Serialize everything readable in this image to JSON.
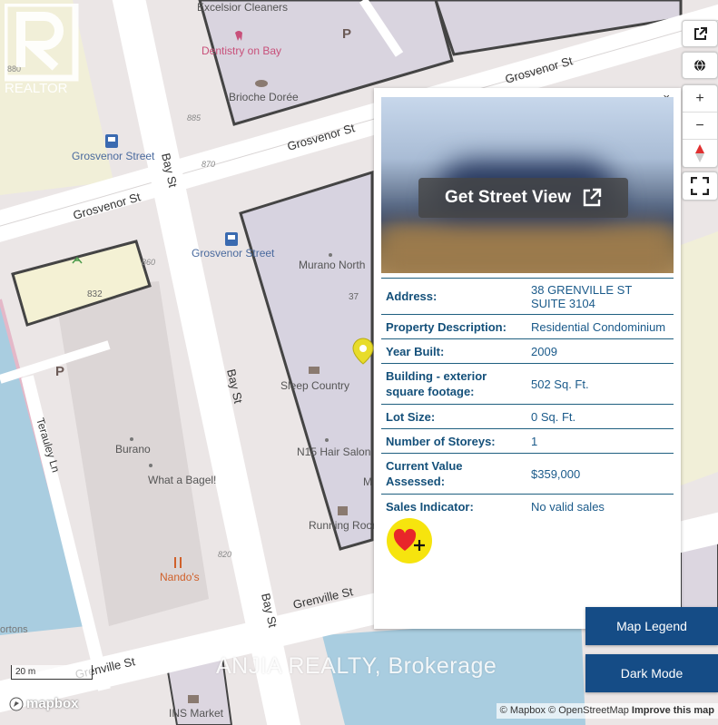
{
  "map": {
    "streets": {
      "grosvenor_st_1": "Grosvenor St",
      "grosvenor_st_2": "Grosvenor St",
      "grosvenor_st_3": "Grosvenor St",
      "bay_st_1": "Bay St",
      "bay_st_2": "Bay St",
      "bay_st_3": "Bay St",
      "grenville_st_1": "Grenville St",
      "grenville_st_2": "Grenville St",
      "terauley_ln": "Terauley Ln"
    },
    "pois": {
      "excelsior": "Excelsior Cleaners",
      "dentistry": "Dentistry on Bay",
      "brioche": "Brioche Dorée",
      "grosvenor_stop_1": "Grosvenor Street",
      "grosvenor_stop_2": "Grosvenor Street",
      "murano": "Murano North",
      "sleep": "Sleep Country",
      "n15": "N15 Hair Salon",
      "running": "Running Room",
      "burano": "Burano",
      "bagel": "What a Bagel!",
      "nandos": "Nando's",
      "ins": "INS Market",
      "hortons": "ortons",
      "parking": "P",
      "m_partial": "M"
    },
    "numbers": {
      "n880": "880",
      "n885": "885",
      "n870": "870",
      "n832": "832",
      "n37": "37",
      "n820": "820",
      "n860": "860"
    }
  },
  "controls": {
    "external_icon": "external-link-icon",
    "globe_icon": "globe-icon",
    "zoom_in": "+",
    "zoom_out": "−",
    "compass_icon": "compass-icon",
    "fullscreen_icon": "fullscreen-icon"
  },
  "popup": {
    "close": "×",
    "street_view_label": "Get Street View",
    "rows": [
      {
        "key": "Address:",
        "value": "38 GRENVILLE ST SUITE 3104"
      },
      {
        "key": "Property Description:",
        "value": "Residential Condominium"
      },
      {
        "key": "Year Built:",
        "value": "2009"
      },
      {
        "key": "Building - exterior square footage:",
        "value": "502 Sq. Ft."
      },
      {
        "key": "Lot Size:",
        "value": "0 Sq. Ft."
      },
      {
        "key": "Number of Storeys:",
        "value": "1"
      },
      {
        "key": "Current Value Assessed:",
        "value": "$359,000"
      },
      {
        "key": "Sales Indicator:",
        "value": "No valid sales"
      }
    ],
    "favorite_icon": "heart-plus-icon"
  },
  "buttons": {
    "map_legend": "Map Legend",
    "dark_mode": "Dark Mode"
  },
  "watermark": "ANJIA REALTY, Brokerage",
  "scale": "20 m",
  "logo": {
    "realtor": "REALTOR",
    "mapbox": "mapbox"
  },
  "attribution": {
    "mapbox": "© Mapbox",
    "osm": "© OpenStreetMap",
    "improve": "Improve this map"
  },
  "colors": {
    "popup_key": "#14507a",
    "button_blue": "#154c86",
    "favorite_yellow": "#f6e40e"
  }
}
